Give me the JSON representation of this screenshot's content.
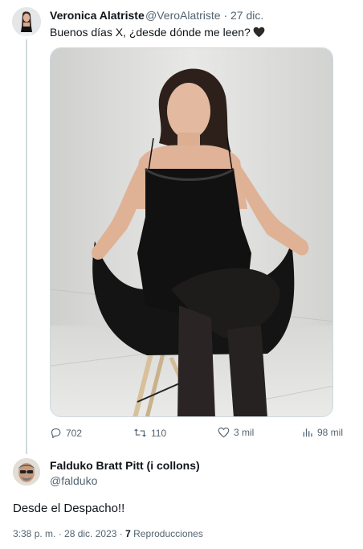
{
  "tweet": {
    "display_name": "Veronica Alatriste",
    "handle_date": "@VeroAlatriste · 27 dic.",
    "text": "Buenos días X, ¿desde dónde me leen?",
    "actions": {
      "replies": "702",
      "reposts": "110",
      "likes": "3 mil",
      "views": "98 mil"
    }
  },
  "reply": {
    "display_name": "Falduko Bratt Pitt (i collons)",
    "handle": "@falduko",
    "text": "Desde el Despacho!!",
    "time": "3:38 p. m. · 28 dic. 2023 ·",
    "views_count": "7",
    "views_label": "Reproducciones"
  },
  "colors": {
    "text": "#0f1419",
    "secondary": "#536471",
    "divider": "#cfd9de"
  },
  "icons": [
    "reply-icon",
    "repost-icon",
    "like-icon",
    "views-icon",
    "black-heart-emoji"
  ]
}
